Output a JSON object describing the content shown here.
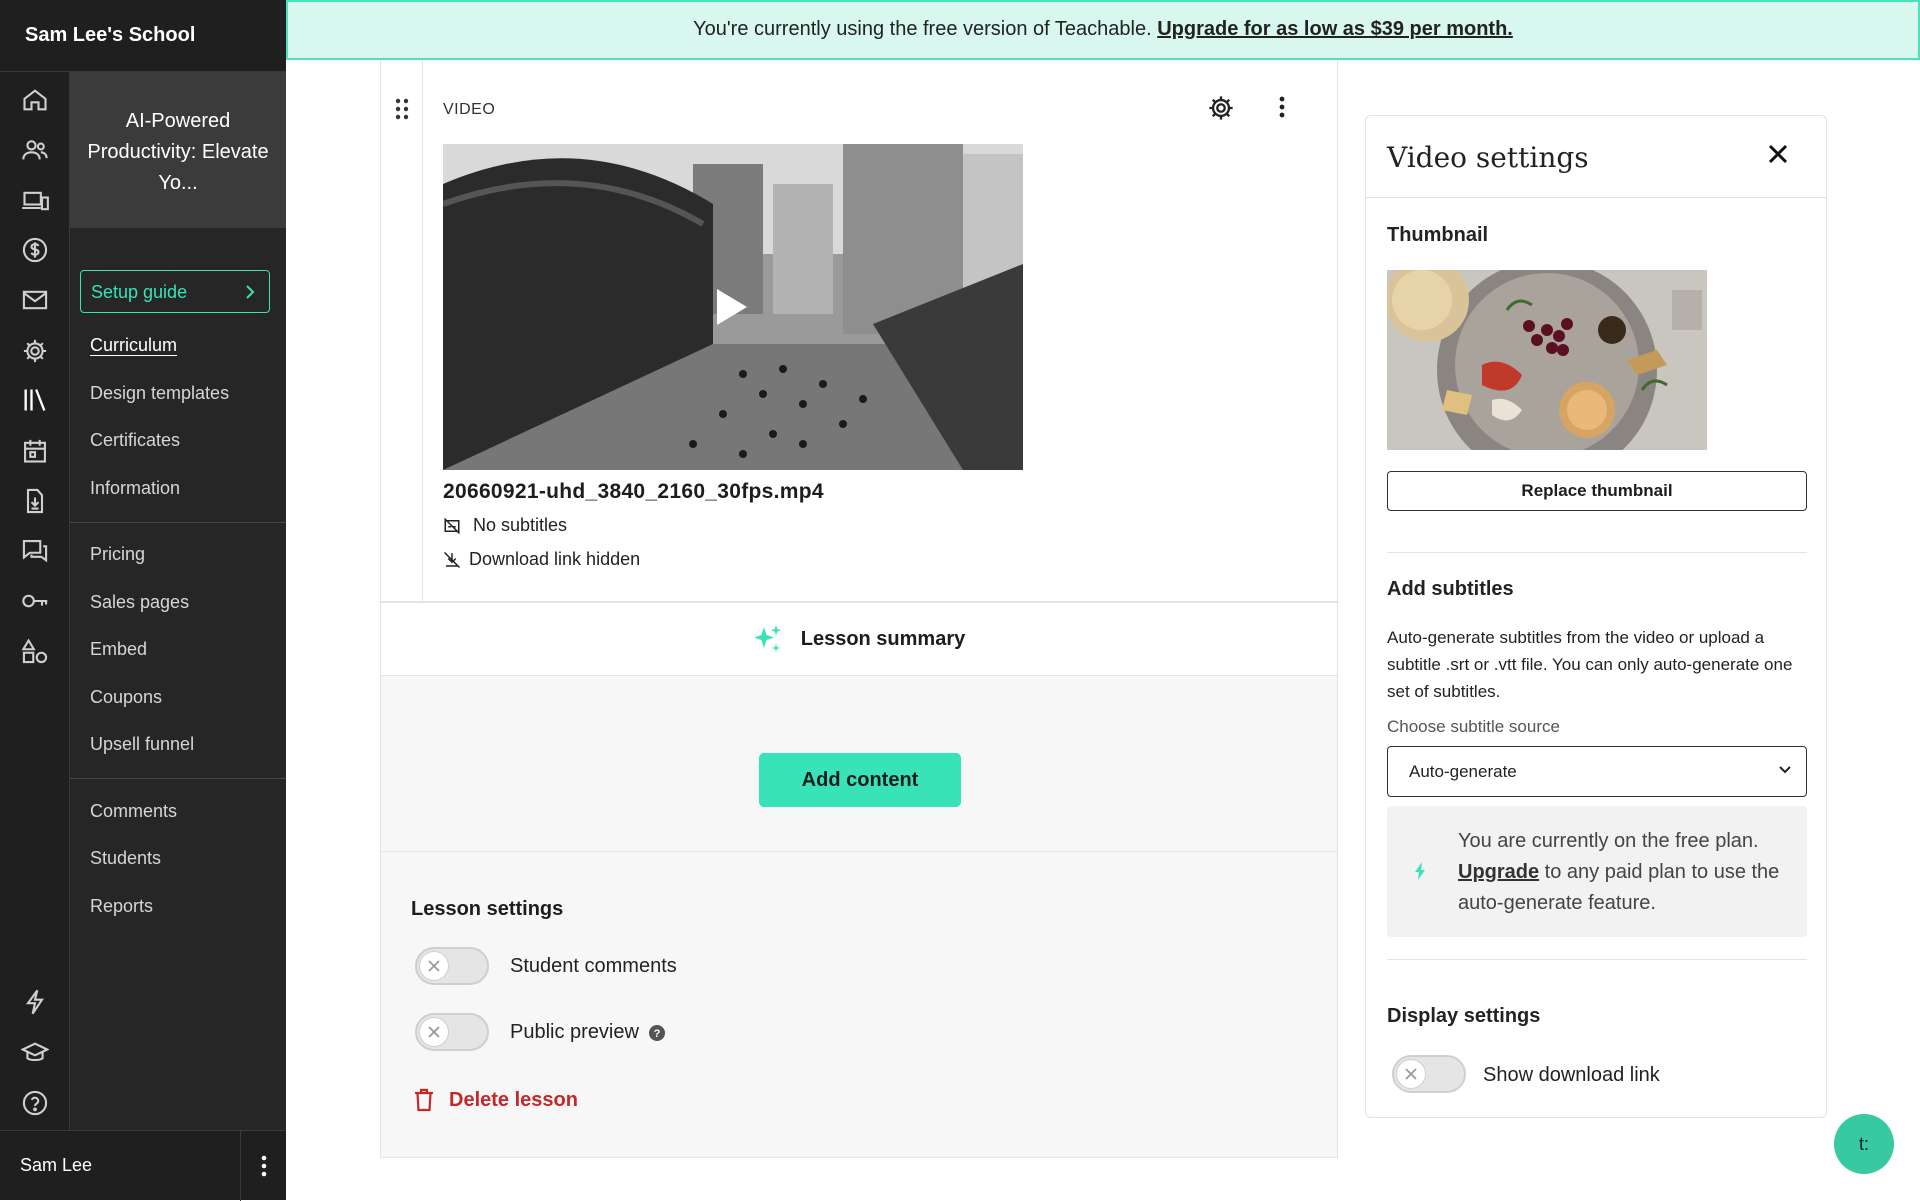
{
  "school": {
    "name": "Sam Lee's School"
  },
  "banner": {
    "text": "You're currently using the free version of Teachable. ",
    "link": "Upgrade for as low as $39 per month."
  },
  "rail_icons": [
    "home-icon",
    "users-icon",
    "devices-icon",
    "dollar-icon",
    "mail-icon",
    "gear-icon",
    "library-icon",
    "calendar-icon",
    "download-icon",
    "chat-icon",
    "key-icon",
    "shapes-icon",
    "lightning-icon",
    "graduation-cap-icon",
    "help-icon"
  ],
  "course_nav": {
    "course_title": "AI-Powered Productivity: Elevate Yo...",
    "setup_guide": "Setup guide",
    "group1": [
      "Curriculum",
      "Design templates",
      "Certificates",
      "Information"
    ],
    "group2": [
      "Pricing",
      "Sales pages",
      "Embed",
      "Coupons",
      "Upsell funnel"
    ],
    "group3": [
      "Comments",
      "Students",
      "Reports"
    ]
  },
  "user": {
    "name": "Sam Lee"
  },
  "video_block": {
    "label": "VIDEO",
    "filename": "20660921-uhd_3840_2160_30fps.mp4",
    "subtitles": "No subtitles",
    "download": "Download link hidden"
  },
  "lesson_summary": "Lesson summary",
  "add_content": "Add content",
  "lesson_settings": {
    "title": "Lesson settings",
    "student_comments": "Student comments",
    "student_comments_on": false,
    "public_preview": "Public preview",
    "public_preview_on": false,
    "delete": "Delete lesson"
  },
  "video_settings": {
    "title": "Video settings",
    "thumbnail_heading": "Thumbnail",
    "replace_thumbnail": "Replace thumbnail",
    "subtitles_heading": "Add subtitles",
    "subtitles_desc": "Auto-generate subtitles from the video or upload a subtitle .srt or .vtt file. You can only auto-generate one set of subtitles.",
    "source_label": "Choose subtitle source",
    "source_value": "Auto-generate",
    "upgrade_pre": "You are currently on the free plan. ",
    "upgrade_link": "Upgrade",
    "upgrade_post": " to any paid plan to use the auto-generate feature.",
    "display_heading": "Display settings",
    "show_download": "Show download link",
    "show_download_on": false
  },
  "chat_bubble": "t:",
  "colors": {
    "accent": "#37e3b7",
    "sidebar": "#1f1f1f",
    "danger": "#c62828",
    "banner_bg": "#d7f7ef"
  }
}
